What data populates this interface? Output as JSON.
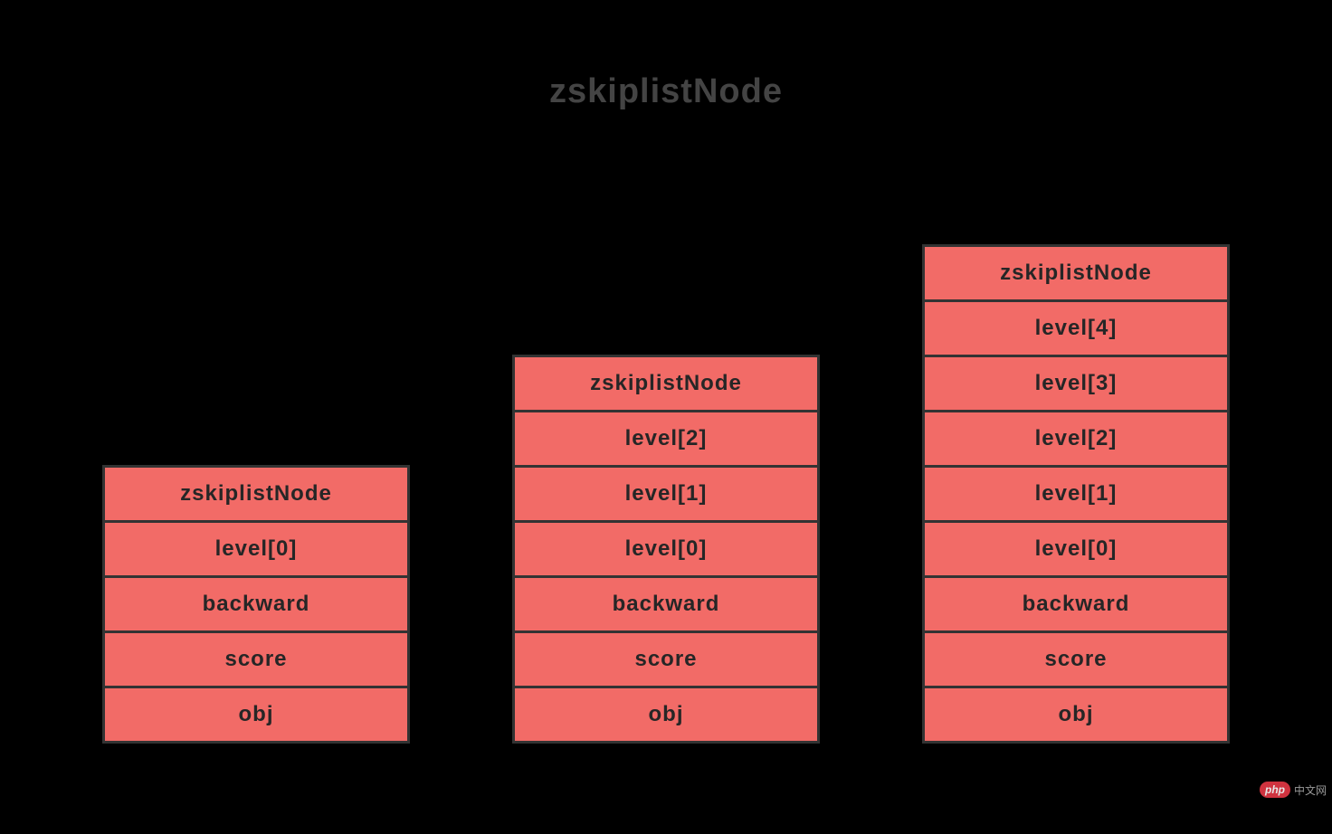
{
  "title": "zskiplistNode",
  "cell_header": "zskiplistNode",
  "level_label": "level",
  "fields": {
    "backward": "backward",
    "score": "score",
    "obj": "obj"
  },
  "nodes": [
    {
      "levels": 1
    },
    {
      "levels": 3
    },
    {
      "levels": 5
    }
  ],
  "watermark": {
    "pill": "php",
    "text": "中文网"
  },
  "colors": {
    "background": "#000000",
    "cell_fill": "#f26b67",
    "cell_border": "#333333",
    "title_text": "#444444",
    "cell_text": "#262626"
  }
}
